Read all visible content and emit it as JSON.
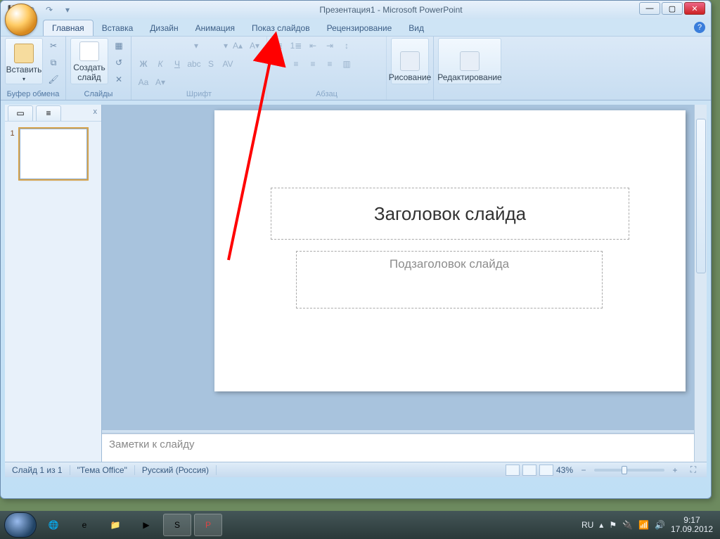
{
  "window": {
    "title": "Презентация1 - Microsoft PowerPoint"
  },
  "tabs": {
    "home": "Главная",
    "insert": "Вставка",
    "design": "Дизайн",
    "animation": "Анимация",
    "slideshow": "Показ слайдов",
    "review": "Рецензирование",
    "view": "Вид"
  },
  "ribbon": {
    "clipboard": {
      "paste": "Вставить",
      "group": "Буфер обмена"
    },
    "slides": {
      "newslide": "Создать\nслайд",
      "group": "Слайды"
    },
    "font": {
      "group": "Шрифт"
    },
    "paragraph": {
      "group": "Абзац"
    },
    "drawing": {
      "btn": "Рисование",
      "group": ""
    },
    "editing": {
      "btn": "Редактирование",
      "group": ""
    }
  },
  "slide": {
    "title_placeholder": "Заголовок слайда",
    "subtitle_placeholder": "Подзаголовок слайда",
    "notes_placeholder": "Заметки к слайду"
  },
  "thumb": {
    "num": "1"
  },
  "status": {
    "slide_pos": "Слайд 1 из 1",
    "theme": "\"Тема Office\"",
    "language": "Русский (Россия)",
    "zoom": "43%",
    "zoom_value": 43
  },
  "taskbar": {
    "lang": "RU",
    "time": "9:17",
    "date": "17.09.2012"
  }
}
